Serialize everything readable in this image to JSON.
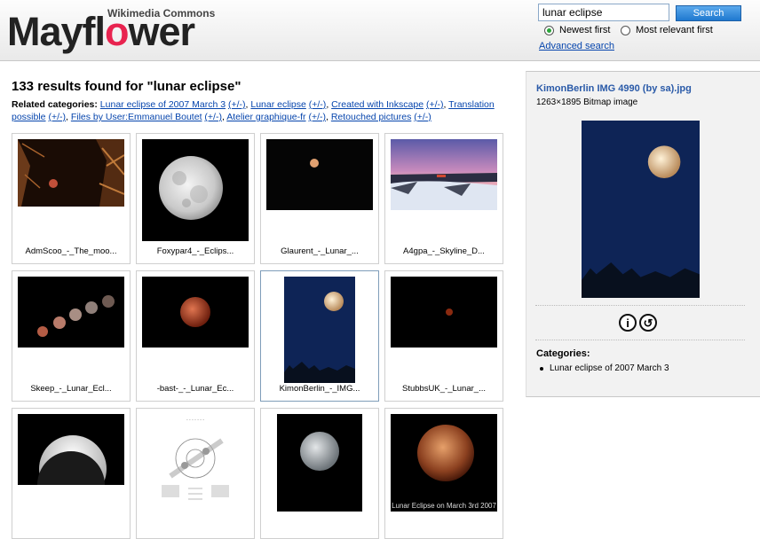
{
  "brand": {
    "logo_main": "Mayfl",
    "logo_accent": "o",
    "logo_rest": "wer",
    "logo_sub": "Wikimedia Commons"
  },
  "search": {
    "query": "lunar eclipse",
    "button_label": "Search",
    "option_newest": "Newest first",
    "option_relevant": "Most relevant first",
    "selected_option": "newest",
    "advanced_label": "Advanced search"
  },
  "results": {
    "title": "133 results found for \"lunar eclipse\"",
    "related_label": "Related categories:",
    "categories": [
      {
        "name": "Lunar eclipse of 2007 March 3",
        "toggle": "(+/-)",
        "sep": ","
      },
      {
        "name": "Lunar eclipse",
        "toggle": "(+/-)",
        "sep": ","
      },
      {
        "name": "Created with Inkscape",
        "toggle": "(+/-)",
        "sep": ","
      },
      {
        "name": "Translation possible",
        "toggle": "(+/-)",
        "sep": ","
      },
      {
        "name": "Files by User:Emmanuel Boutet",
        "toggle": "(+/-)",
        "sep": ","
      },
      {
        "name": "Atelier graphique-fr",
        "toggle": "(+/-)",
        "sep": ","
      },
      {
        "name": "Retouched pictures",
        "toggle": "(+/-)",
        "sep": ""
      }
    ],
    "items": [
      {
        "caption": "AdmScoo_-_The_moo...",
        "kind": "trees-moon"
      },
      {
        "caption": "Foxypar4_-_Eclips...",
        "kind": "full-moon"
      },
      {
        "caption": "Glaurent_-_Lunar_...",
        "kind": "small-moon"
      },
      {
        "caption": "A4gpa_-_Skyline_D...",
        "kind": "skyline"
      },
      {
        "caption": "Skeep_-_Lunar_Ecl...",
        "kind": "sequence"
      },
      {
        "caption": "-bast-_-_Lunar_Ec...",
        "kind": "red-moon"
      },
      {
        "caption": "KimonBerlin_-_IMG...",
        "kind": "blue-moon"
      },
      {
        "caption": "StubbsUK_-_Lunar_...",
        "kind": "tiny-red"
      },
      {
        "caption": "",
        "kind": "crescent"
      },
      {
        "caption": "",
        "kind": "diagram"
      },
      {
        "caption": "",
        "kind": "grey-moon"
      },
      {
        "caption": "",
        "kind": "copper-moon",
        "overlay": "Lunar Eclipse on March 3rd 2007"
      }
    ],
    "selected_index": 6
  },
  "detail": {
    "title": "KimonBerlin IMG 4990 (by sa).jpg",
    "dims": "1263×1895 Bitmap image",
    "license_icons": [
      "attribution-icon",
      "share-alike-icon"
    ],
    "categories_heading": "Categories:",
    "categories": [
      "Lunar eclipse of 2007 March 3"
    ]
  },
  "colors": {
    "accent": "#e8234f",
    "link": "#0645ad",
    "button": "#1f78cf",
    "radio_on": "#2aa53a"
  }
}
